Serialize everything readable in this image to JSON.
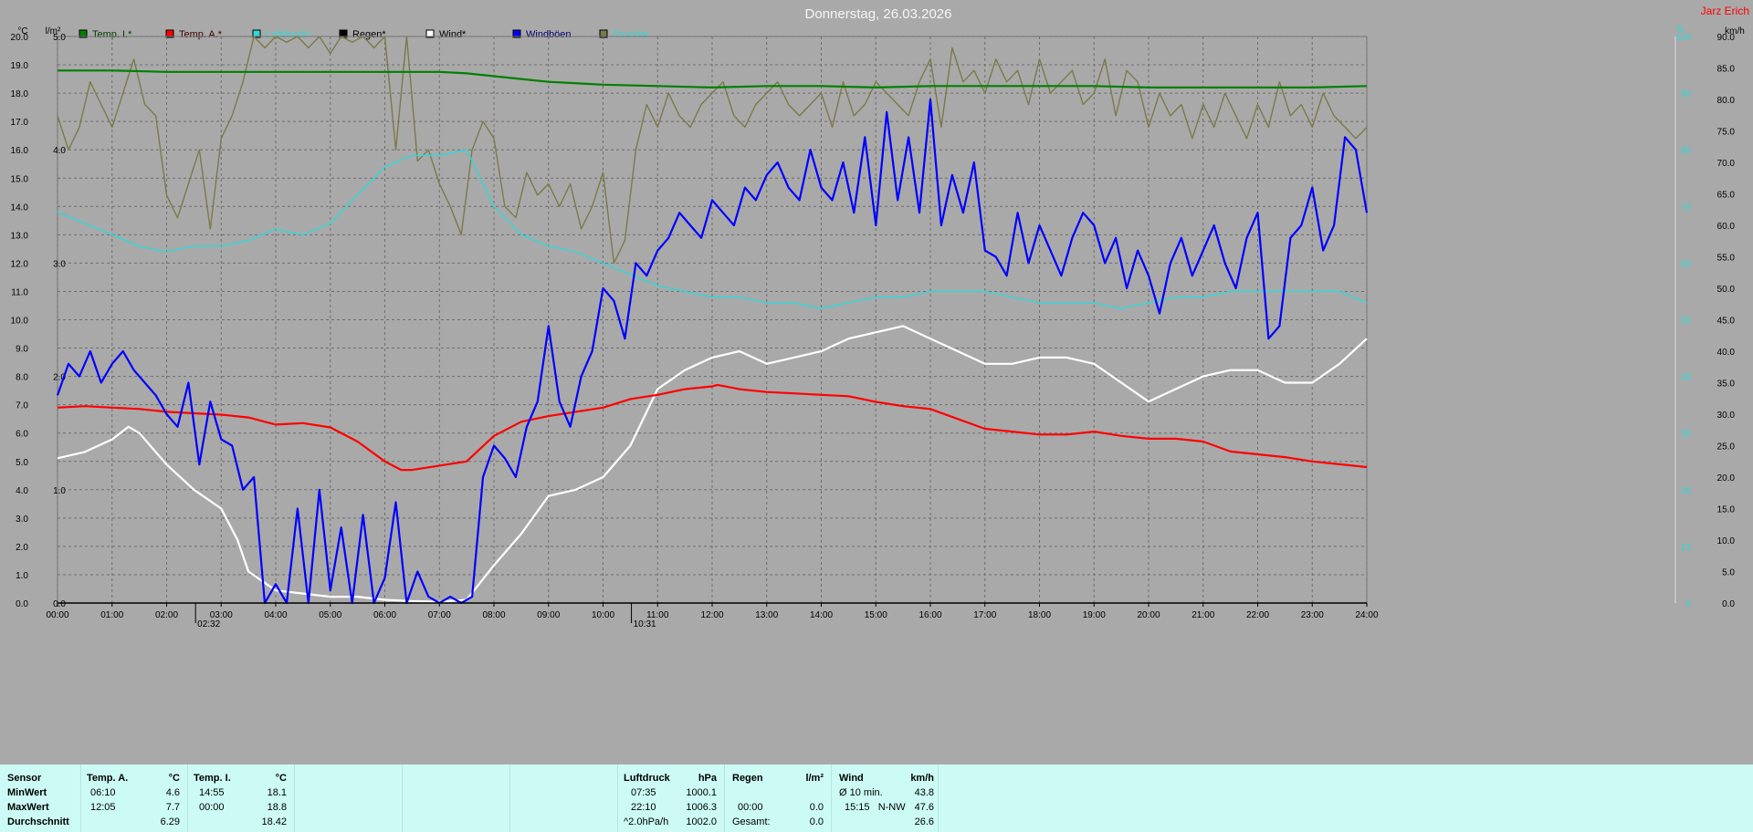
{
  "title": "Donnerstag, 26.03.2026",
  "author": "Jarz Erich",
  "colors": {
    "background": "#a9a9a9",
    "grid": "#6e6e6e",
    "temp_i": "#008000",
    "temp_a": "#ff0000",
    "luftdruck": "#30d8d8",
    "regen": "#000000",
    "wind": "#ffffff",
    "windboeen": "#0000ff",
    "feuchte": "#7a7a4a",
    "author": "#ff0000",
    "title": "#f5f5f5",
    "summary_bg": "#ccfbf5"
  },
  "chart_data": {
    "type": "line",
    "title": "Donnerstag, 26.03.2026",
    "x_ticks": [
      "00:00",
      "01:00",
      "02:00",
      "03:00",
      "04:00",
      "05:00",
      "06:00",
      "07:00",
      "08:00",
      "09:00",
      "10:00",
      "11:00",
      "12:00",
      "13:00",
      "14:00",
      "15:00",
      "16:00",
      "17:00",
      "18:00",
      "19:00",
      "20:00",
      "21:00",
      "22:00",
      "23:00",
      "24:00"
    ],
    "x_range_hours": [
      0,
      24
    ],
    "axes": {
      "temp": {
        "unit": "°C",
        "range": [
          0,
          20
        ],
        "ticks": [
          "0.0",
          "1.0",
          "2.0",
          "3.0",
          "4.0",
          "5.0",
          "6.0",
          "7.0",
          "8.0",
          "9.0",
          "10.0",
          "11.0",
          "12.0",
          "13.0",
          "14.0",
          "15.0",
          "16.0",
          "17.0",
          "18.0",
          "19.0",
          "20.0"
        ]
      },
      "rain": {
        "unit": "l/m²",
        "range": [
          0,
          5
        ],
        "ticks": [
          "0.0",
          "1.0",
          "2.0",
          "3.0",
          "4.0",
          "5.0"
        ]
      },
      "percent": {
        "unit": "%",
        "range": [
          0,
          100
        ],
        "ticks": [
          "0",
          "10",
          "20",
          "30",
          "40",
          "50",
          "60",
          "70",
          "80",
          "90",
          "100"
        ]
      },
      "wind": {
        "unit": "km/h",
        "range": [
          0,
          90
        ],
        "ticks": [
          "0.0",
          "5.0",
          "10.0",
          "15.0",
          "20.0",
          "25.0",
          "30.0",
          "35.0",
          "40.0",
          "45.0",
          "50.0",
          "55.0",
          "60.0",
          "65.0",
          "70.0",
          "75.0",
          "80.0",
          "85.0",
          "90.0"
        ]
      }
    },
    "grid": true,
    "legend_position": "top",
    "markers": [
      {
        "label": "02:32",
        "x": 2.53
      },
      {
        "label": "10:31",
        "x": 10.52
      }
    ],
    "series": [
      {
        "name": "Temp. I.*",
        "axis": "temp",
        "color": "#008000",
        "x": [
          0,
          1,
          2,
          3,
          4,
          5,
          6,
          7,
          7.5,
          8,
          8.5,
          9,
          10,
          11,
          12,
          13,
          14,
          15,
          16,
          17,
          18,
          19,
          20,
          21,
          22,
          23,
          24
        ],
        "y": [
          18.8,
          18.8,
          18.75,
          18.75,
          18.75,
          18.75,
          18.75,
          18.75,
          18.7,
          18.6,
          18.5,
          18.4,
          18.3,
          18.25,
          18.2,
          18.25,
          18.25,
          18.2,
          18.25,
          18.25,
          18.25,
          18.25,
          18.2,
          18.2,
          18.2,
          18.2,
          18.25
        ]
      },
      {
        "name": "Temp. A.*",
        "axis": "temp",
        "color": "#ff0000",
        "x": [
          0,
          0.5,
          1,
          1.5,
          2,
          2.5,
          3,
          3.5,
          4,
          4.5,
          5,
          5.5,
          6,
          6.3,
          6.5,
          7,
          7.5,
          8,
          8.5,
          9,
          9.5,
          10,
          10.5,
          11,
          11.5,
          12,
          12.1,
          12.5,
          13,
          13.5,
          14,
          14.5,
          15,
          15.5,
          16,
          16.5,
          17,
          17.5,
          18,
          18.5,
          19,
          19.5,
          20,
          20.5,
          21,
          21.5,
          22,
          22.5,
          23,
          23.5,
          24
        ],
        "y": [
          6.9,
          6.95,
          6.9,
          6.85,
          6.75,
          6.7,
          6.65,
          6.55,
          6.3,
          6.35,
          6.2,
          5.7,
          5.0,
          4.7,
          4.7,
          4.85,
          5.0,
          5.9,
          6.4,
          6.6,
          6.75,
          6.9,
          7.2,
          7.35,
          7.55,
          7.65,
          7.7,
          7.55,
          7.45,
          7.4,
          7.35,
          7.3,
          7.1,
          6.95,
          6.85,
          6.5,
          6.15,
          6.05,
          5.95,
          5.95,
          6.05,
          5.9,
          5.8,
          5.8,
          5.7,
          5.35,
          5.25,
          5.15,
          5.0,
          4.9,
          4.8
        ]
      },
      {
        "name": "Luftdruck*",
        "axis": "percent",
        "color": "#30d8d8",
        "x": [
          0,
          0.5,
          1,
          1.5,
          2,
          2.5,
          3,
          3.5,
          4,
          4.5,
          5,
          5.5,
          6,
          6.5,
          7,
          7.5,
          8,
          8.5,
          9,
          9.5,
          10,
          10.5,
          11,
          11.5,
          12,
          12.5,
          13,
          13.5,
          14,
          14.5,
          15,
          15.5,
          16,
          16.5,
          17,
          17.5,
          18,
          18.5,
          19,
          19.5,
          20,
          20.5,
          21,
          21.5,
          22,
          22.5,
          23,
          23.5,
          24
        ],
        "y": [
          69,
          67,
          65,
          63,
          62,
          63,
          63,
          64,
          66,
          65,
          67,
          72,
          77,
          79,
          79,
          80,
          70,
          65,
          63,
          62,
          60,
          58,
          56,
          55,
          54,
          54,
          53,
          53,
          52,
          53,
          54,
          54,
          55,
          55,
          55,
          54,
          53,
          53,
          53,
          52,
          53,
          54,
          54,
          55,
          55,
          55,
          55,
          55,
          53
        ]
      },
      {
        "name": "Regen*",
        "axis": "rain",
        "color": "#000000",
        "x": [
          0,
          24
        ],
        "y": [
          0,
          0
        ]
      },
      {
        "name": "Wind*",
        "axis": "wind",
        "color": "#ffffff",
        "x": [
          0,
          0.5,
          1,
          1.3,
          1.5,
          2,
          2.5,
          3,
          3.3,
          3.5,
          4,
          4.5,
          5,
          5.5,
          6,
          6.5,
          7,
          7.5,
          8,
          8.5,
          9,
          9.5,
          10,
          10.5,
          11,
          11.5,
          12,
          12.5,
          13,
          13.5,
          14,
          14.5,
          15,
          15.5,
          16,
          16.5,
          17,
          17.5,
          18,
          18.5,
          19,
          19.5,
          20,
          20.5,
          21,
          21.5,
          22,
          22.5,
          23,
          23.5,
          24
        ],
        "y": [
          23,
          24,
          26,
          28,
          27,
          22,
          18,
          15,
          10,
          5,
          2,
          1.5,
          1,
          1,
          0.5,
          0.3,
          0.2,
          0.5,
          6,
          11,
          17,
          18,
          20,
          25,
          34,
          37,
          39,
          40,
          38,
          39,
          40,
          42,
          43,
          44,
          42,
          40,
          38,
          38,
          39,
          39,
          38,
          35,
          32,
          34,
          36,
          37,
          37,
          35,
          35,
          38,
          42
        ]
      },
      {
        "name": "Windböen",
        "axis": "wind",
        "color": "#0000ff",
        "x": [
          0,
          0.2,
          0.4,
          0.6,
          0.8,
          1,
          1.2,
          1.4,
          1.6,
          1.8,
          2,
          2.2,
          2.4,
          2.6,
          2.8,
          3,
          3.2,
          3.4,
          3.6,
          3.8,
          4,
          4.2,
          4.4,
          4.6,
          4.8,
          5,
          5.2,
          5.4,
          5.6,
          5.8,
          6,
          6.2,
          6.4,
          6.6,
          6.8,
          7,
          7.2,
          7.4,
          7.6,
          7.8,
          8,
          8.2,
          8.4,
          8.6,
          8.8,
          9,
          9.2,
          9.4,
          9.6,
          9.8,
          10,
          10.2,
          10.4,
          10.6,
          10.8,
          11,
          11.2,
          11.4,
          11.6,
          11.8,
          12,
          12.2,
          12.4,
          12.6,
          12.8,
          13,
          13.2,
          13.4,
          13.6,
          13.8,
          14,
          14.2,
          14.4,
          14.6,
          14.8,
          15,
          15.2,
          15.4,
          15.6,
          15.8,
          16,
          16.2,
          16.4,
          16.6,
          16.8,
          17,
          17.2,
          17.4,
          17.6,
          17.8,
          18,
          18.2,
          18.4,
          18.6,
          18.8,
          19,
          19.2,
          19.4,
          19.6,
          19.8,
          20,
          20.2,
          20.4,
          20.6,
          20.8,
          21,
          21.2,
          21.4,
          21.6,
          21.8,
          22,
          22.2,
          22.4,
          22.6,
          22.8,
          23,
          23.2,
          23.4,
          23.6,
          23.8,
          24
        ],
        "y": [
          33,
          38,
          36,
          40,
          35,
          38,
          40,
          37,
          35,
          33,
          30,
          28,
          35,
          22,
          32,
          26,
          25,
          18,
          20,
          0,
          3,
          0,
          15,
          0,
          18,
          2,
          12,
          0,
          14,
          0,
          4,
          16,
          0,
          5,
          1,
          0,
          1,
          0,
          1,
          20,
          25,
          23,
          20,
          28,
          32,
          44,
          32,
          28,
          36,
          40,
          50,
          48,
          42,
          54,
          52,
          56,
          58,
          62,
          60,
          58,
          64,
          62,
          60,
          66,
          64,
          68,
          70,
          66,
          64,
          72,
          66,
          64,
          70,
          62,
          74,
          60,
          78,
          64,
          74,
          62,
          80,
          60,
          68,
          62,
          70,
          56,
          55,
          52,
          62,
          54,
          60,
          56,
          52,
          58,
          62,
          60,
          54,
          58,
          50,
          56,
          52,
          46,
          54,
          58,
          52,
          56,
          60,
          54,
          50,
          58,
          62,
          42,
          44,
          58,
          60,
          66,
          56,
          60,
          74,
          72,
          62
        ]
      },
      {
        "name": "Feuchte",
        "axis": "percent",
        "color": "#7a7a4a",
        "x": [
          0,
          0.2,
          0.4,
          0.6,
          0.8,
          1,
          1.2,
          1.4,
          1.6,
          1.8,
          2,
          2.2,
          2.4,
          2.6,
          2.8,
          3,
          3.2,
          3.4,
          3.6,
          3.8,
          4,
          4.2,
          4.4,
          4.6,
          4.8,
          5,
          5.2,
          5.4,
          5.6,
          5.8,
          6,
          6.2,
          6.4,
          6.6,
          6.8,
          7,
          7.2,
          7.4,
          7.6,
          7.8,
          8,
          8.2,
          8.4,
          8.6,
          8.8,
          9,
          9.2,
          9.4,
          9.6,
          9.8,
          10,
          10.2,
          10.4,
          10.6,
          10.8,
          11,
          11.2,
          11.4,
          11.6,
          11.8,
          12,
          12.2,
          12.4,
          12.6,
          12.8,
          13,
          13.2,
          13.4,
          13.6,
          13.8,
          14,
          14.2,
          14.4,
          14.6,
          14.8,
          15,
          15.2,
          15.4,
          15.6,
          15.8,
          16,
          16.2,
          16.4,
          16.6,
          16.8,
          17,
          17.2,
          17.4,
          17.6,
          17.8,
          18,
          18.2,
          18.4,
          18.6,
          18.8,
          19,
          19.2,
          19.4,
          19.6,
          19.8,
          20,
          20.2,
          20.4,
          20.6,
          20.8,
          21,
          21.2,
          21.4,
          21.6,
          21.8,
          22,
          22.2,
          22.4,
          22.6,
          22.8,
          23,
          23.2,
          23.4,
          23.6,
          23.8,
          24
        ],
        "y": [
          86,
          80,
          84,
          92,
          88,
          84,
          90,
          96,
          88,
          86,
          72,
          68,
          74,
          80,
          66,
          82,
          86,
          92,
          100,
          98,
          100,
          99,
          100,
          98,
          100,
          97,
          100,
          99,
          100,
          98,
          100,
          80,
          100,
          78,
          80,
          74,
          70,
          65,
          80,
          85,
          82,
          70,
          68,
          76,
          72,
          74,
          70,
          74,
          66,
          70,
          76,
          60,
          64,
          80,
          88,
          84,
          90,
          86,
          84,
          88,
          90,
          92,
          86,
          84,
          88,
          90,
          92,
          88,
          86,
          88,
          90,
          84,
          92,
          86,
          88,
          92,
          90,
          88,
          86,
          92,
          96,
          84,
          98,
          92,
          94,
          90,
          96,
          92,
          94,
          88,
          96,
          90,
          92,
          94,
          88,
          90,
          96,
          86,
          94,
          92,
          84,
          90,
          86,
          88,
          82,
          88,
          84,
          90,
          86,
          82,
          88,
          84,
          92,
          86,
          88,
          84,
          90,
          86,
          84,
          82,
          84
        ]
      }
    ]
  },
  "summary": {
    "sensor": {
      "header": "Sensor",
      "rows": [
        "MinWert",
        "MaxWert",
        "Durchschnitt"
      ]
    },
    "temp_a": {
      "header": "Temp. A.",
      "unit": "°C",
      "rows": [
        [
          "06:10",
          "4.6"
        ],
        [
          "12:05",
          "7.7"
        ],
        [
          "",
          "6.29"
        ]
      ]
    },
    "temp_i": {
      "header": "Temp. I.",
      "unit": "°C",
      "rows": [
        [
          "14:55",
          "18.1"
        ],
        [
          "00:00",
          "18.8"
        ],
        [
          "",
          "18.42"
        ]
      ]
    },
    "luftdruck": {
      "header": "Luftdruck",
      "unit": "hPa",
      "rows": [
        [
          "07:35",
          "1000.1"
        ],
        [
          "22:10",
          "1006.3"
        ],
        [
          "^2.0hPa/h",
          "1002.0"
        ]
      ]
    },
    "regen": {
      "header": "Regen",
      "unit": "l/m²",
      "rows": [
        [
          "",
          ""
        ],
        [
          "00:00",
          "0.0"
        ],
        [
          "Gesamt:",
          "0.0"
        ]
      ]
    },
    "wind": {
      "header": "Wind",
      "unit": "km/h",
      "rows": [
        [
          "Ø 10 min.",
          "43.8"
        ],
        [
          "15:15   N-NW",
          "47.6"
        ],
        [
          "",
          "26.6"
        ]
      ]
    }
  }
}
